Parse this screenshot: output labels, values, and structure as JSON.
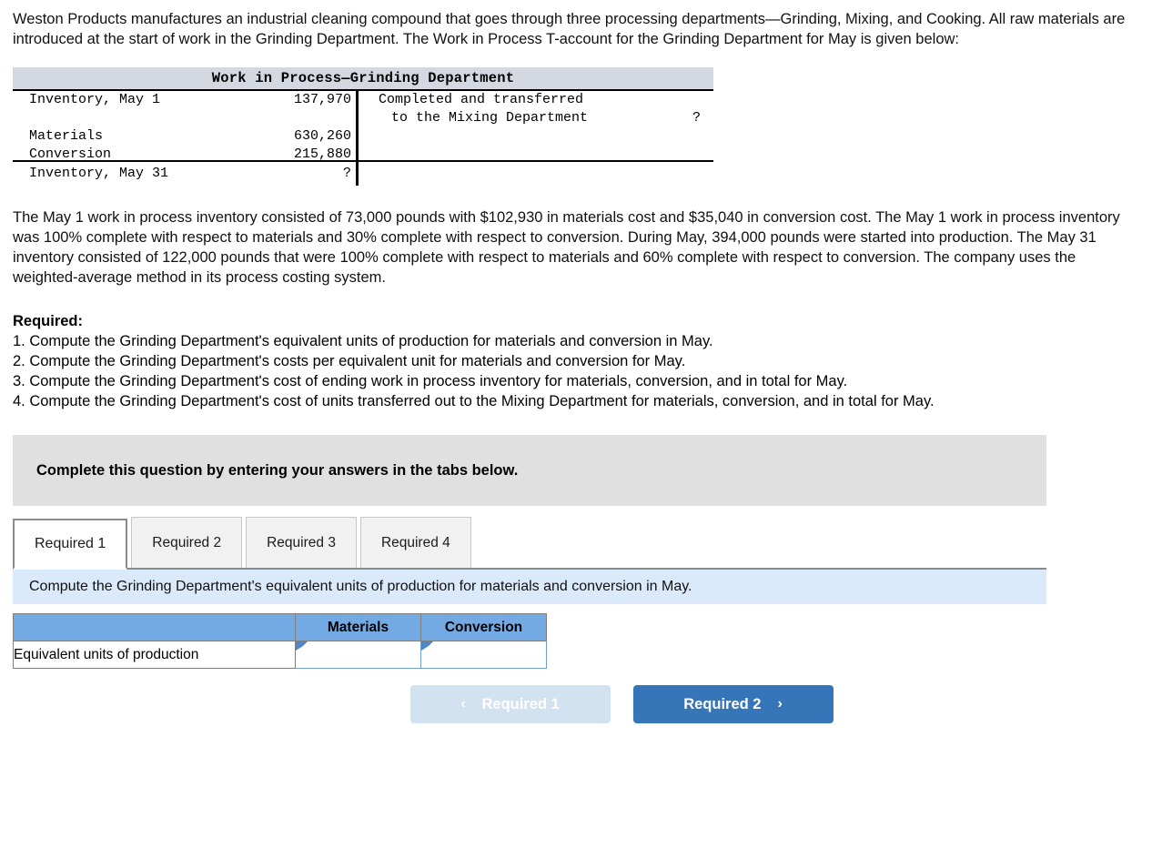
{
  "problem": {
    "intro": "Weston Products manufactures an industrial cleaning compound that goes through three processing departments—Grinding, Mixing, and Cooking. All raw materials are introduced at the start of work in the Grinding Department. The Work in Process T-account for the Grinding Department for May is given below:",
    "facts": "The May 1 work in process inventory consisted of 73,000 pounds with $102,930 in materials cost and $35,040 in conversion cost. The May 1 work in process inventory was 100% complete with respect to materials and 30% complete with respect to conversion. During May, 394,000 pounds were started into production. The May 31 inventory consisted of 122,000 pounds that were 100% complete with respect to materials and 60% complete with respect to conversion. The company uses the weighted-average method in its process costing system."
  },
  "t_account": {
    "title": "Work in Process—Grinding Department",
    "left_rows": [
      {
        "label": "Inventory, May 1",
        "amount": "137,970"
      },
      {
        "label": "Materials",
        "amount": "630,260"
      },
      {
        "label": "Conversion",
        "amount": "215,880"
      }
    ],
    "left_footer": {
      "label": "Inventory, May 31",
      "amount": "?"
    },
    "right_rows": [
      {
        "label": "Completed and transferred",
        "amount": ""
      },
      {
        "label": "to the Mixing Department",
        "amount": "?"
      }
    ]
  },
  "required": {
    "heading": "Required:",
    "items": [
      "1. Compute the Grinding Department's equivalent units of production for materials and conversion in May.",
      "2. Compute the Grinding Department's costs per equivalent unit for materials and conversion for May.",
      "3. Compute the Grinding Department's cost of ending work in process inventory for materials, conversion, and in total for May.",
      "4. Compute the Grinding Department's cost of units transferred out to the Mixing Department for materials, conversion, and in total for May."
    ]
  },
  "instruction_bar": {
    "text": "Complete this question by entering your answers in the tabs below."
  },
  "tabs": [
    {
      "label": "Required 1",
      "active": true
    },
    {
      "label": "Required 2",
      "active": false
    },
    {
      "label": "Required 3",
      "active": false
    },
    {
      "label": "Required 4",
      "active": false
    }
  ],
  "sub_instruction": {
    "text": "Compute the Grinding Department's equivalent units of production for materials and conversion in May."
  },
  "answer_table": {
    "headers": [
      "",
      "Materials",
      "Conversion"
    ],
    "rows": [
      {
        "label": "Equivalent units of production",
        "materials": "",
        "conversion": ""
      }
    ]
  },
  "navigation": {
    "prev_label": "Required 1",
    "next_label": "Required 2",
    "prev_icon": "chevron-left-icon",
    "next_icon": "chevron-right-icon",
    "prev_chevron": "‹",
    "next_chevron": "›"
  },
  "colors": {
    "table_header_blue": "#74aae4",
    "primary_button_blue": "#3676b8",
    "disabled_button_blue": "#d2e2f0",
    "sub_instruction_blue": "#dbeafb",
    "instruction_gray": "#e0e0e0",
    "t_account_header_gray": "#d4d8e0"
  }
}
